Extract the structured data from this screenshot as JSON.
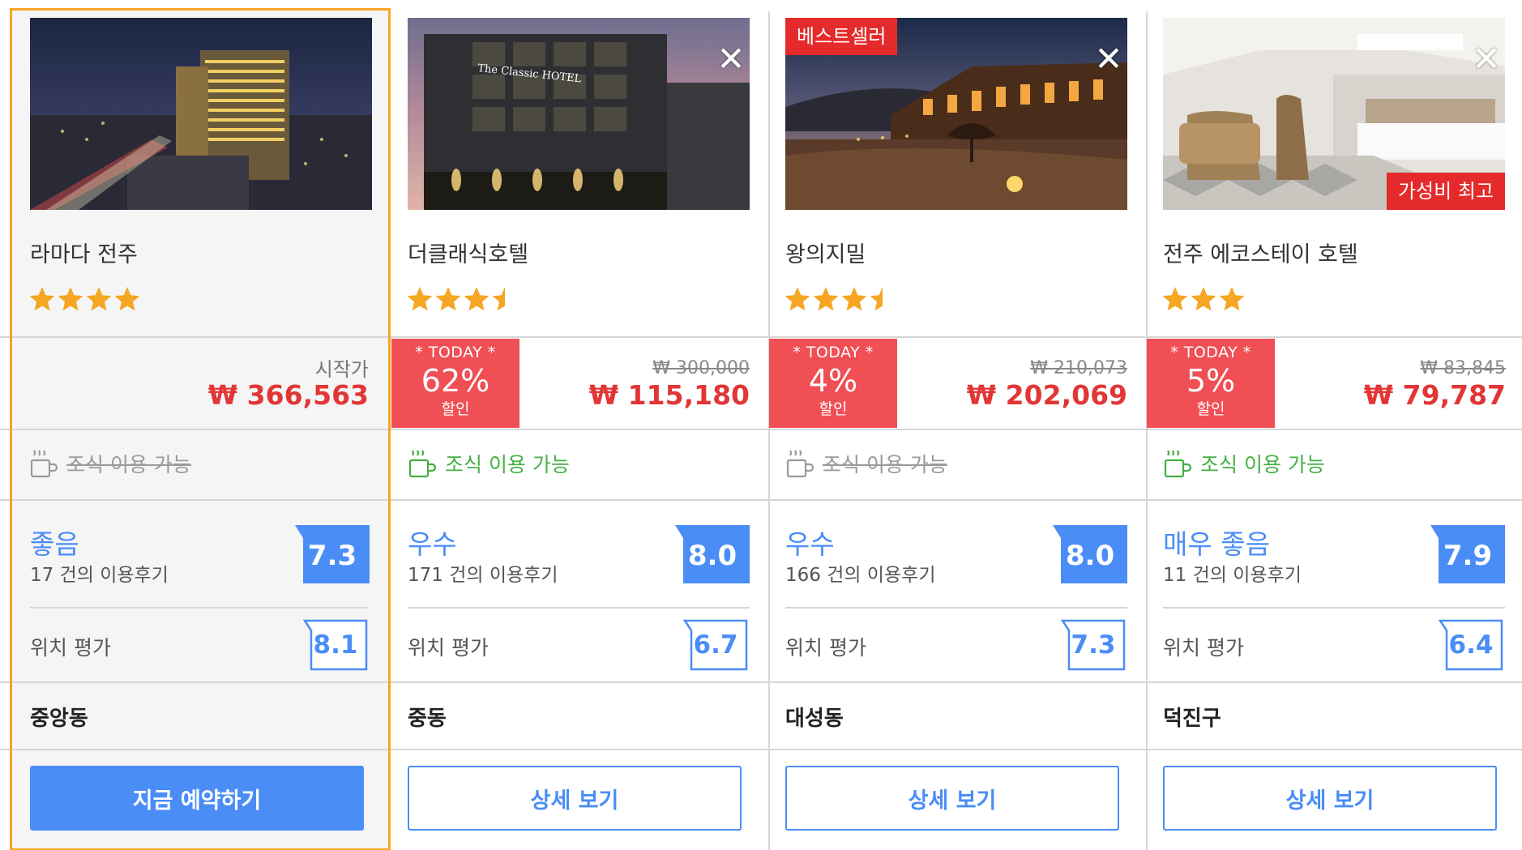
{
  "colors": {
    "accent_blue": "#4a8df6",
    "price_red": "#e23636",
    "deal_red": "#ef4f55",
    "highlight_border": "#f5a623",
    "breakfast_green": "#43b043",
    "star_orange": "#f5a623"
  },
  "hotels": [
    {
      "name": "라마다 전주",
      "stars": 4,
      "photo_alt": "라마다 전주",
      "ribbon_top": "",
      "ribbon_bottom": "",
      "closable": false,
      "highlighted": true,
      "price_label": "시작가",
      "old_price": "",
      "price": "₩ 366,563",
      "deal": null,
      "breakfast_available": false,
      "breakfast_text": "조식 이용 가능",
      "rating_word": "좋음",
      "review_count": "17 건의 이용후기",
      "score": "7.3",
      "location_label": "위치 평가",
      "location_score": "8.1",
      "district": "중앙동",
      "button_label": "지금 예약하기",
      "button_style": "primary"
    },
    {
      "name": "더클래식호텔",
      "stars": 3.5,
      "photo_alt": "더클래식호텔",
      "ribbon_top": "",
      "ribbon_bottom": "",
      "closable": true,
      "highlighted": false,
      "price_label": "",
      "old_price": "₩ 300,000",
      "price": "₩ 115,180",
      "deal": {
        "tag": "* TODAY *",
        "percent": "62%",
        "label": "할인"
      },
      "breakfast_available": true,
      "breakfast_text": "조식 이용 가능",
      "rating_word": "우수",
      "review_count": "171 건의 이용후기",
      "score": "8.0",
      "location_label": "위치 평가",
      "location_score": "6.7",
      "district": "중동",
      "button_label": "상세 보기",
      "button_style": "outline"
    },
    {
      "name": "왕의지밀",
      "stars": 3.5,
      "photo_alt": "왕의지밀",
      "ribbon_top": "베스트셀러",
      "ribbon_bottom": "",
      "closable": true,
      "highlighted": false,
      "price_label": "",
      "old_price": "₩ 210,073",
      "price": "₩ 202,069",
      "deal": {
        "tag": "* TODAY *",
        "percent": "4%",
        "label": "할인"
      },
      "breakfast_available": false,
      "breakfast_text": "조식 이용 가능",
      "rating_word": "우수",
      "review_count": "166 건의 이용후기",
      "score": "8.0",
      "location_label": "위치 평가",
      "location_score": "7.3",
      "district": "대성동",
      "button_label": "상세 보기",
      "button_style": "outline"
    },
    {
      "name": "전주 에코스테이 호텔",
      "stars": 3,
      "photo_alt": "전주 에코스테이 호텔",
      "ribbon_top": "",
      "ribbon_bottom": "가성비 최고",
      "closable": true,
      "highlighted": false,
      "price_label": "",
      "old_price": "₩ 83,845",
      "price": "₩ 79,787",
      "deal": {
        "tag": "* TODAY *",
        "percent": "5%",
        "label": "할인"
      },
      "breakfast_available": true,
      "breakfast_text": "조식 이용 가능",
      "rating_word": "매우 좋음",
      "review_count": "11 건의 이용후기",
      "score": "7.9",
      "location_label": "위치 평가",
      "location_score": "6.4",
      "district": "덕진구",
      "button_label": "상세 보기",
      "button_style": "outline"
    }
  ],
  "close_glyph": "✕"
}
